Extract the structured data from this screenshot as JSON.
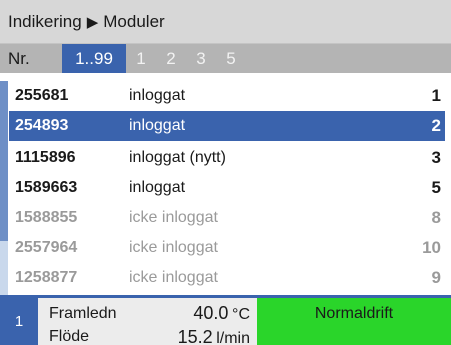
{
  "header": {
    "crumb_1": "Indikering",
    "separator": "▶",
    "crumb_2": "Moduler"
  },
  "tabs": {
    "nr_label": "Nr.",
    "items": [
      "1..99",
      "1",
      "2",
      "3",
      "5"
    ],
    "active_index": 0
  },
  "list": {
    "rows": [
      {
        "number": "255681",
        "status": "inloggat",
        "index": "1"
      },
      {
        "number": "254893",
        "status": "inloggat",
        "index": "2"
      },
      {
        "number": "1115896",
        "status": "inloggat (nytt)",
        "index": "3"
      },
      {
        "number": "1589663",
        "status": "inloggat",
        "index": "5"
      },
      {
        "number": "1588855",
        "status": "icke inloggat",
        "index": "8"
      },
      {
        "number": "2557964",
        "status": "icke inloggat",
        "index": "10"
      },
      {
        "number": "1258877",
        "status": "icke inloggat",
        "index": "9"
      }
    ],
    "selected_row": 1
  },
  "footer": {
    "circuit": "1",
    "label_1": "Framledn",
    "value_1": "40.0",
    "unit_1": "°C",
    "label_2": "Flöde",
    "value_2": "15.2",
    "unit_2": "l/min",
    "mode": "Normaldrift"
  },
  "colors": {
    "accent": "#3a63ad",
    "status_ok": "#2ad52a",
    "inactive_text": "#9a9a9a"
  }
}
